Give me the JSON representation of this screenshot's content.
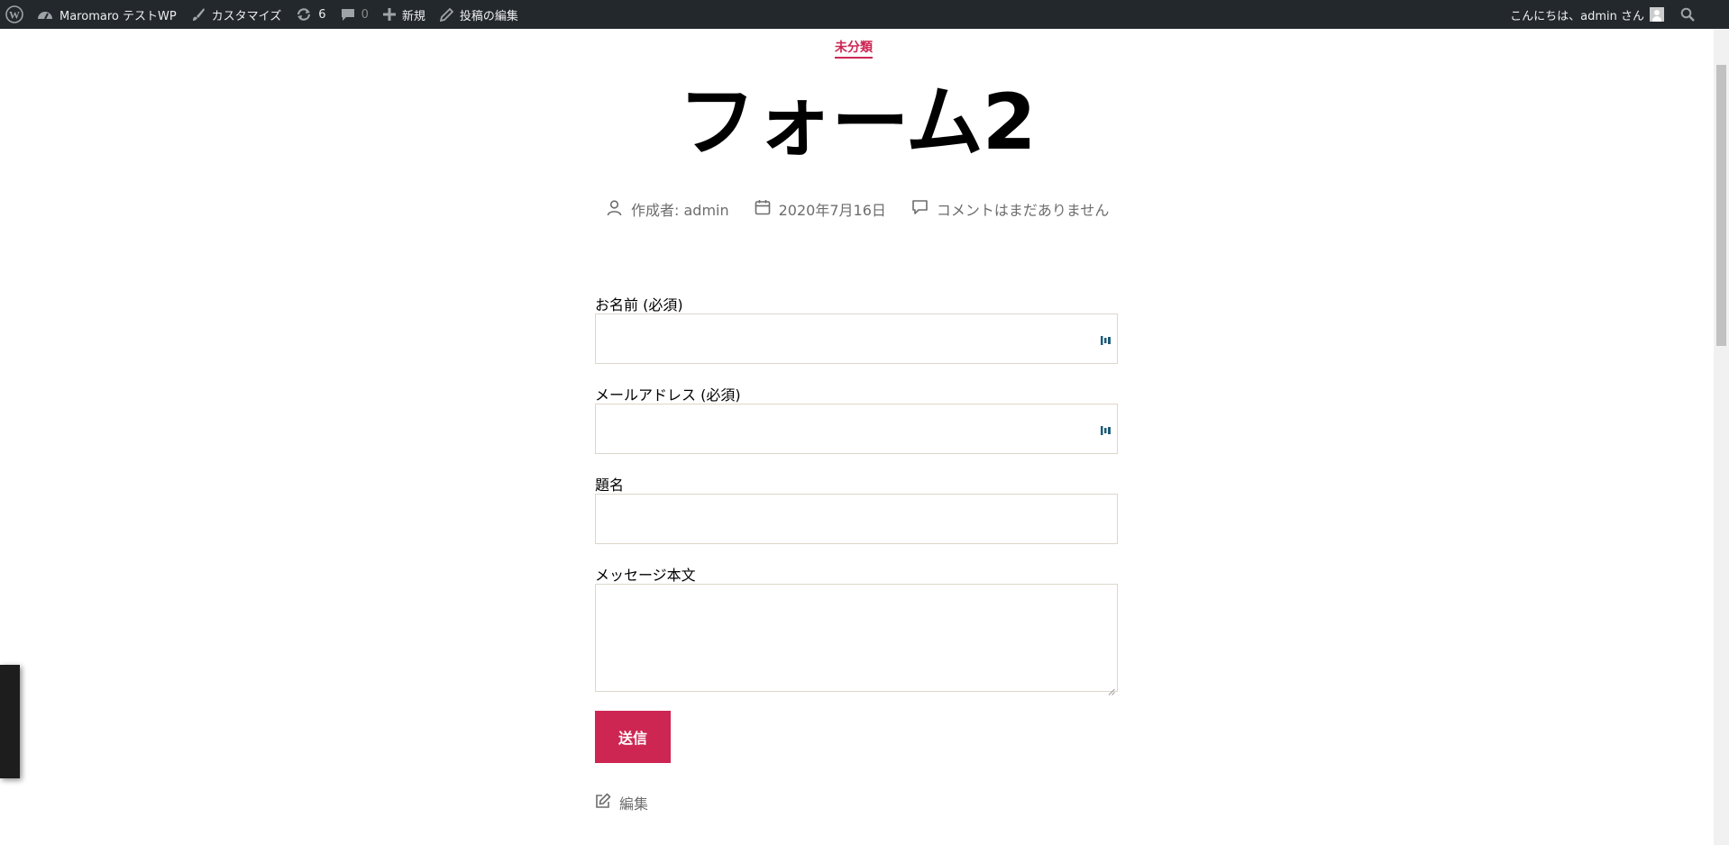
{
  "adminbar": {
    "site_name": "Maromaro テストWP",
    "customize_label": "カスタマイズ",
    "updates_count": "6",
    "comments_count": "0",
    "new_label": "新規",
    "edit_post_label": "投稿の編集",
    "greeting": "こんにちは、admin さん"
  },
  "post": {
    "category": "未分類",
    "title": "フォーム2",
    "meta": {
      "author": "作成者: admin",
      "date": "2020年7月16日",
      "comments": "コメントはまだありません"
    }
  },
  "form": {
    "name_label": "お名前 (必須)",
    "email_label": "メールアドレス (必須)",
    "subject_label": "題名",
    "message_label": "メッセージ本文",
    "name_value": "",
    "email_value": "",
    "subject_value": "",
    "message_value": "",
    "submit_label": "送信"
  },
  "edit_link": "編集",
  "colors": {
    "accent": "#cd2653",
    "adminbar_bg": "#23282d",
    "meta_text": "#6d6d6d"
  }
}
